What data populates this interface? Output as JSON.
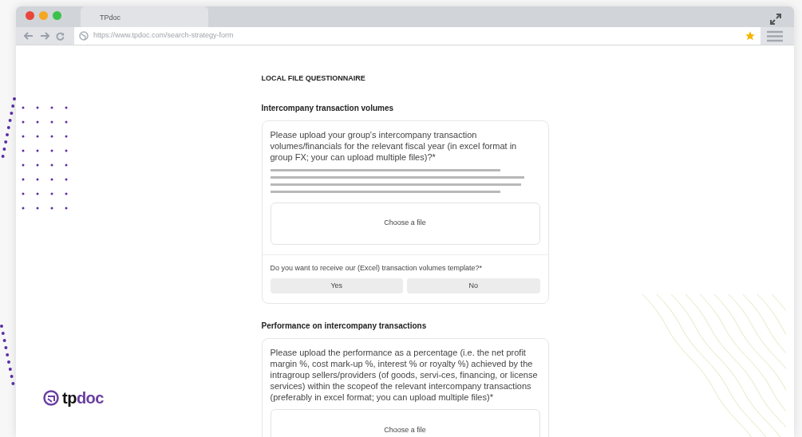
{
  "browser": {
    "tab_title": "TPdoc",
    "url": "https://www.tpdoc.com/search-strategy-form"
  },
  "page_title": "LOCAL FILE QUESTIONNAIRE",
  "sections": [
    {
      "heading": "Intercompany transaction volumes",
      "question": "Please upload your group's intercompany transaction volumes/financials for the relevant fiscal year (in excel format in group FX; your can upload multiple files)?*",
      "upload_label": "Choose a file",
      "follow_up": {
        "question": "Do you want to receive our (Excel) transaction volumes template?*",
        "options": [
          "Yes",
          "No"
        ]
      }
    },
    {
      "heading": "Performance on intercompany transactions",
      "question": "Please upload the performance as a percentage (i.e. the net profit margin %, cost mark-up %, interest % or royalty %) achieved by the intragroup sellers/providers (of goods, servi-ces, financing, or license services) within the scopeof the relevant intercompany transactions (preferably in excel format; you can upload multiple files)*",
      "upload_label": "Choose a file"
    }
  ],
  "logo": {
    "dark_part": "tp",
    "accent_part": "doc"
  }
}
